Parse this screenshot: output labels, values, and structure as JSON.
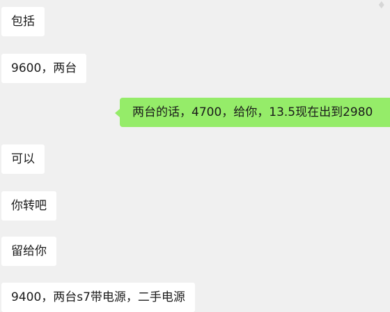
{
  "messages": [
    {
      "side": "in",
      "text": "包括"
    },
    {
      "side": "in",
      "text": "9600，两台"
    },
    {
      "side": "out",
      "text": "两台的话，4700，给你，13.5现在出到2980"
    },
    {
      "side": "in",
      "text": "可以"
    },
    {
      "side": "in",
      "text": "你转吧"
    },
    {
      "side": "in",
      "text": "留给你"
    },
    {
      "side": "in",
      "text": "9400，两台s7带电源，二手电源"
    }
  ],
  "colors": {
    "background": "#f0f0f0",
    "incoming_bubble": "#ffffff",
    "outgoing_bubble": "#95ec69"
  }
}
